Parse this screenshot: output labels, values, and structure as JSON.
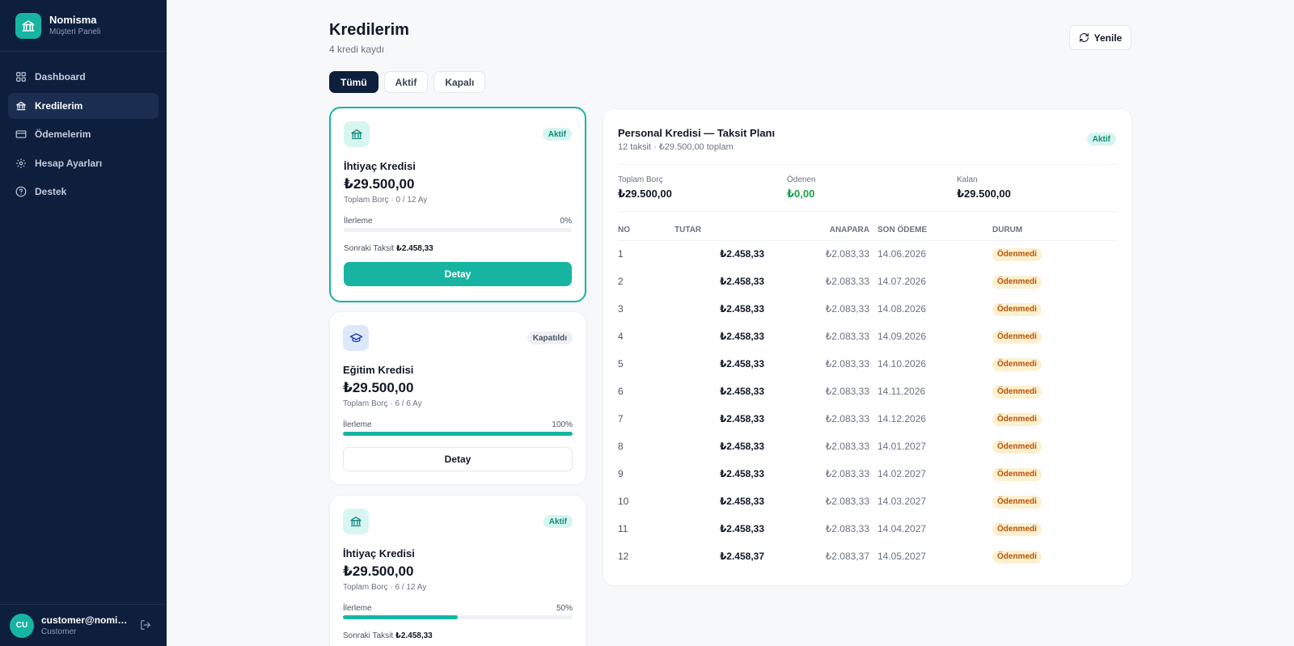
{
  "brand": {
    "name": "Nomisma",
    "subtitle": "Müşteri Paneli"
  },
  "nav": [
    {
      "label": "Dashboard",
      "icon": "grid-icon",
      "active": false
    },
    {
      "label": "Kredilerim",
      "icon": "bank-icon",
      "active": true
    },
    {
      "label": "Ödemelerim",
      "icon": "card-icon",
      "active": false
    },
    {
      "label": "Hesap Ayarları",
      "icon": "gear-icon",
      "active": false
    },
    {
      "label": "Destek",
      "icon": "help-icon",
      "active": false
    }
  ],
  "user": {
    "initials": "CU",
    "email": "customer@nomisma.com",
    "role": "Customer"
  },
  "header": {
    "title": "Kredilerim",
    "subtitle": "4 kredi kaydı",
    "refresh_label": "Yenile"
  },
  "tabs": [
    {
      "label": "Tümü",
      "active": true
    },
    {
      "label": "Aktif",
      "active": false
    },
    {
      "label": "Kapalı",
      "active": false
    }
  ],
  "loans": [
    {
      "name": "İhtiyaç Kredisi",
      "amount": "₺29.500,00",
      "meta": "Toplam Borç · 0 / 12 Ay",
      "status": "Aktif",
      "icon": "bank-icon",
      "progress_label": "İlerleme",
      "progress_text": "0%",
      "progress": 0,
      "next_label": "Sonraki Taksit",
      "next_value": "₺2.458,33",
      "detail_label": "Detay",
      "selected": true
    },
    {
      "name": "Eğitim Kredisi",
      "amount": "₺29.500,00",
      "meta": "Toplam Borç · 6 / 6 Ay",
      "status": "Kapatıldı",
      "icon": "graduation-cap-icon",
      "progress_label": "İlerleme",
      "progress_text": "100%",
      "progress": 100,
      "detail_label": "Detay",
      "selected": false
    },
    {
      "name": "İhtiyaç Kredisi",
      "amount": "₺29.500,00",
      "meta": "Toplam Borç · 6 / 12 Ay",
      "status": "Aktif",
      "icon": "bank-icon",
      "progress_label": "İlerleme",
      "progress_text": "50%",
      "progress": 50,
      "next_label": "Sonraki Taksit",
      "next_value": "₺2.458,33",
      "selected": false
    }
  ],
  "plan": {
    "title": "Personal Kredisi — Taksit Planı",
    "subtitle": "12 taksit · ₺29.500,00 toplam",
    "status": "Aktif",
    "summary": [
      {
        "label": "Toplam Borç",
        "value": "₺29.500,00"
      },
      {
        "label": "Ödenen",
        "value": "₺0,00"
      },
      {
        "label": "Kalan",
        "value": "₺29.500,00"
      }
    ],
    "columns": [
      "NO",
      "TUTAR",
      "ANAPARA",
      "SON ÖDEME",
      "DURUM"
    ],
    "rows": [
      {
        "no": "1",
        "amount": "₺2.458,33",
        "principal": "₺2.083,33",
        "due": "14.06.2026",
        "status": "Ödenmedi"
      },
      {
        "no": "2",
        "amount": "₺2.458,33",
        "principal": "₺2.083,33",
        "due": "14.07.2026",
        "status": "Ödenmedi"
      },
      {
        "no": "3",
        "amount": "₺2.458,33",
        "principal": "₺2.083,33",
        "due": "14.08.2026",
        "status": "Ödenmedi"
      },
      {
        "no": "4",
        "amount": "₺2.458,33",
        "principal": "₺2.083,33",
        "due": "14.09.2026",
        "status": "Ödenmedi"
      },
      {
        "no": "5",
        "amount": "₺2.458,33",
        "principal": "₺2.083,33",
        "due": "14.10.2026",
        "status": "Ödenmedi"
      },
      {
        "no": "6",
        "amount": "₺2.458,33",
        "principal": "₺2.083,33",
        "due": "14.11.2026",
        "status": "Ödenmedi"
      },
      {
        "no": "7",
        "amount": "₺2.458,33",
        "principal": "₺2.083,33",
        "due": "14.12.2026",
        "status": "Ödenmedi"
      },
      {
        "no": "8",
        "amount": "₺2.458,33",
        "principal": "₺2.083,33",
        "due": "14.01.2027",
        "status": "Ödenmedi"
      },
      {
        "no": "9",
        "amount": "₺2.458,33",
        "principal": "₺2.083,33",
        "due": "14.02.2027",
        "status": "Ödenmedi"
      },
      {
        "no": "10",
        "amount": "₺2.458,33",
        "principal": "₺2.083,33",
        "due": "14.03.2027",
        "status": "Ödenmedi"
      },
      {
        "no": "11",
        "amount": "₺2.458,33",
        "principal": "₺2.083,33",
        "due": "14.04.2027",
        "status": "Ödenmedi"
      },
      {
        "no": "12",
        "amount": "₺2.458,37",
        "principal": "₺2.083,37",
        "due": "14.05.2027",
        "status": "Ödenmedi"
      }
    ]
  },
  "colors": {
    "sidebar": "#0e1f3d",
    "accent": "#17b5a1",
    "paid_green": "#16a34a",
    "unpaid_bg": "#fdf0cf",
    "unpaid_text": "#b45309"
  }
}
